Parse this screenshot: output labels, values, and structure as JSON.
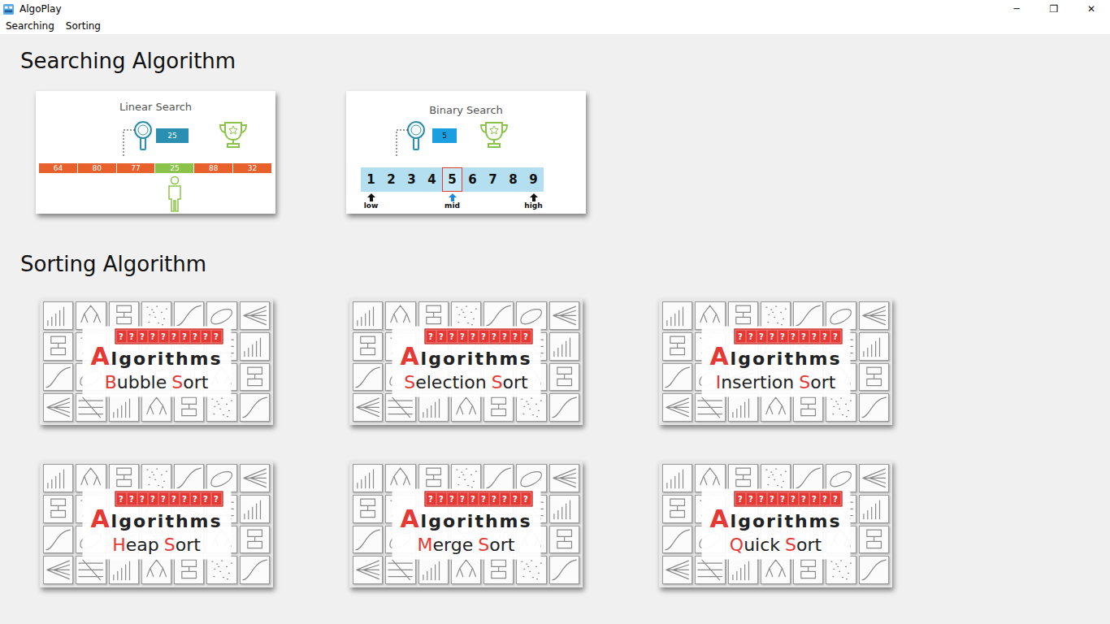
{
  "window": {
    "title": "AlgoPlay",
    "controls": [
      "─",
      "❐",
      "✕"
    ]
  },
  "menu": [
    {
      "label": "Searching"
    },
    {
      "label": "Sorting"
    }
  ],
  "searching": {
    "heading": "Searching Algorithm",
    "cards": [
      {
        "kind": "linear",
        "title": "Linear Search",
        "target": "25",
        "values": [
          {
            "value": "64",
            "found": false
          },
          {
            "value": "80",
            "found": false
          },
          {
            "value": "77",
            "found": false
          },
          {
            "value": "25",
            "found": true
          },
          {
            "value": "88",
            "found": false
          },
          {
            "value": "32",
            "found": false
          }
        ]
      },
      {
        "kind": "binary",
        "title": "Binary Search",
        "target": "5",
        "values": [
          {
            "value": "1",
            "found": false,
            "pointer": {
              "label": "low",
              "color": "#111111"
            }
          },
          {
            "value": "2",
            "found": false,
            "pointer": null
          },
          {
            "value": "3",
            "found": false,
            "pointer": null
          },
          {
            "value": "4",
            "found": false,
            "pointer": null
          },
          {
            "value": "5",
            "found": true,
            "pointer": {
              "label": "mid",
              "color": "#1e88e5"
            }
          },
          {
            "value": "6",
            "found": false,
            "pointer": null
          },
          {
            "value": "7",
            "found": false,
            "pointer": null
          },
          {
            "value": "8",
            "found": false,
            "pointer": null
          },
          {
            "value": "9",
            "found": false,
            "pointer": {
              "label": "high",
              "color": "#111111"
            }
          }
        ]
      }
    ]
  },
  "sorting": {
    "heading": "Sorting Algorithm",
    "banner": "Algorithms",
    "marks": [
      "?",
      "?",
      "?",
      "?",
      "?",
      "?",
      "?",
      "?",
      "?",
      "?"
    ],
    "cards": [
      {
        "name_words": [
          "Bubble",
          "Sort"
        ]
      },
      {
        "name_words": [
          "Selection",
          "Sort"
        ]
      },
      {
        "name_words": [
          "Insertion",
          "Sort"
        ]
      },
      {
        "name_words": [
          "Heap",
          "Sort"
        ]
      },
      {
        "name_words": [
          "Merge",
          "Sort"
        ]
      },
      {
        "name_words": [
          "Quick",
          "Sort"
        ]
      }
    ]
  }
}
